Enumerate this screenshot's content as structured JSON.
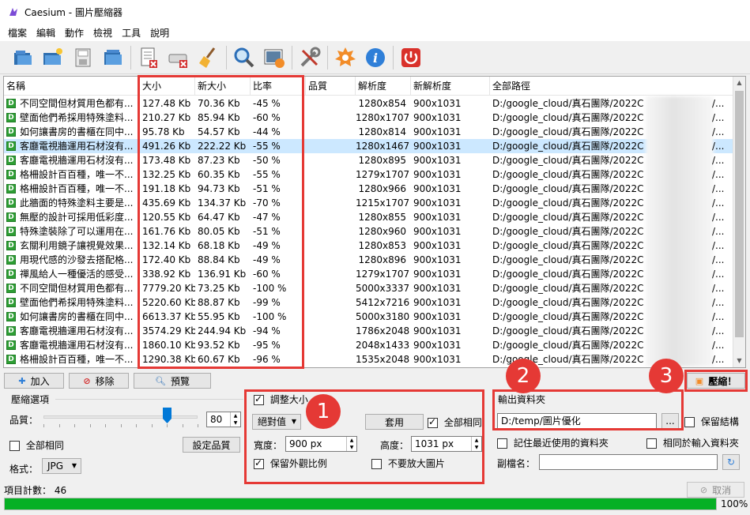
{
  "window": {
    "title": "Caesium - 圖片壓縮器"
  },
  "menu": [
    "檔案",
    "編輯",
    "動作",
    "檢視",
    "工具",
    "說明"
  ],
  "toolbar": {
    "icons": [
      "open-file-icon",
      "open-folder-icon",
      "save-icon",
      "save-all-icon",
      "remove-item-icon",
      "clear-list-icon",
      "broom-clean-icon",
      "search-icon",
      "preview-image-icon",
      "settings-tools-icon",
      "update-icon",
      "info-icon",
      "exit-icon"
    ]
  },
  "table": {
    "columns": [
      "名稱",
      "大小",
      "新大小",
      "比率",
      "品質",
      "解析度",
      "新解析度",
      "全部路徑"
    ],
    "rows": [
      {
        "name": "不同空間但材質用色都有...",
        "size": "127.48 Kb",
        "new_size": "70.36 Kb",
        "ratio": "-45 %",
        "res": "1280x854",
        "new_res": "900x1031",
        "path": "D:/google_cloud/真石團隊/2022C",
        "tail": "/..."
      },
      {
        "name": "壁面他們希採用特殊塗料...",
        "size": "210.27 Kb",
        "new_size": "85.94 Kb",
        "ratio": "-60 %",
        "res": "1280x1707",
        "new_res": "900x1031",
        "path": "D:/google_cloud/真石團隊/2022C",
        "tail": "/..."
      },
      {
        "name": "如何讓書房的書櫃在同中...",
        "size": "95.78 Kb",
        "new_size": "54.57 Kb",
        "ratio": "-44 %",
        "res": "1280x814",
        "new_res": "900x1031",
        "path": "D:/google_cloud/真石團隊/2022C",
        "tail": "/..."
      },
      {
        "name": "客廳電視牆運用石材沒有...",
        "size": "491.26 Kb",
        "new_size": "222.22 Kb",
        "ratio": "-55 %",
        "res": "1280x1467",
        "new_res": "900x1031",
        "path": "D:/google_cloud/真石團隊/2022C",
        "tail": "/..."
      },
      {
        "name": "客廳電視牆運用石材沒有...",
        "size": "173.48 Kb",
        "new_size": "87.23 Kb",
        "ratio": "-50 %",
        "res": "1280x895",
        "new_res": "900x1031",
        "path": "D:/google_cloud/真石團隊/2022C",
        "tail": "/..."
      },
      {
        "name": "格柵設計百百種，唯一不...",
        "size": "132.25 Kb",
        "new_size": "60.35 Kb",
        "ratio": "-55 %",
        "res": "1279x1707",
        "new_res": "900x1031",
        "path": "D:/google_cloud/真石團隊/2022C",
        "tail": "/..."
      },
      {
        "name": "格柵設計百百種，唯一不...",
        "size": "191.18 Kb",
        "new_size": "94.73 Kb",
        "ratio": "-51 %",
        "res": "1280x966",
        "new_res": "900x1031",
        "path": "D:/google_cloud/真石團隊/2022C",
        "tail": "/..."
      },
      {
        "name": "此牆面的特殊塗料主要是...",
        "size": "435.69 Kb",
        "new_size": "134.37 Kb",
        "ratio": "-70 %",
        "res": "1215x1707",
        "new_res": "900x1031",
        "path": "D:/google_cloud/真石團隊/2022C",
        "tail": "/..."
      },
      {
        "name": "無壓的設計可採用低彩度...",
        "size": "120.55 Kb",
        "new_size": "64.47 Kb",
        "ratio": "-47 %",
        "res": "1280x855",
        "new_res": "900x1031",
        "path": "D:/google_cloud/真石團隊/2022C",
        "tail": "/..."
      },
      {
        "name": "特殊塗裝除了可以運用在...",
        "size": "161.76 Kb",
        "new_size": "80.05 Kb",
        "ratio": "-51 %",
        "res": "1280x960",
        "new_res": "900x1031",
        "path": "D:/google_cloud/真石團隊/2022C",
        "tail": "/..."
      },
      {
        "name": "玄關利用鏡子讓視覺效果...",
        "size": "132.14 Kb",
        "new_size": "68.18 Kb",
        "ratio": "-49 %",
        "res": "1280x853",
        "new_res": "900x1031",
        "path": "D:/google_cloud/真石團隊/2022C",
        "tail": "/..."
      },
      {
        "name": "用現代感的沙發去搭配格...",
        "size": "172.40 Kb",
        "new_size": "88.84 Kb",
        "ratio": "-49 %",
        "res": "1280x896",
        "new_res": "900x1031",
        "path": "D:/google_cloud/真石團隊/2022C",
        "tail": "/..."
      },
      {
        "name": "禪風給人一種優活的感受...",
        "size": "338.92 Kb",
        "new_size": "136.91 Kb",
        "ratio": "-60 %",
        "res": "1279x1707",
        "new_res": "900x1031",
        "path": "D:/google_cloud/真石團隊/2022C",
        "tail": "/..."
      },
      {
        "name": "不同空間但材質用色都有...",
        "size": "7779.20 Kb",
        "new_size": "73.25 Kb",
        "ratio": "-100 %",
        "res": "5000x3337",
        "new_res": "900x1031",
        "path": "D:/google_cloud/真石團隊/2022C",
        "tail": "/..."
      },
      {
        "name": "壁面他們希採用特殊塗料...",
        "size": "5220.60 Kb",
        "new_size": "88.87 Kb",
        "ratio": "-99 %",
        "res": "5412x7216",
        "new_res": "900x1031",
        "path": "D:/google_cloud/真石團隊/2022C",
        "tail": "/..."
      },
      {
        "name": "如何讓書房的書櫃在同中...",
        "size": "6613.37 Kb",
        "new_size": "55.95 Kb",
        "ratio": "-100 %",
        "res": "5000x3180",
        "new_res": "900x1031",
        "path": "D:/google_cloud/真石團隊/2022C",
        "tail": "/..."
      },
      {
        "name": "客廳電視牆運用石材沒有...",
        "size": "3574.29 Kb",
        "new_size": "244.94 Kb",
        "ratio": "-94 %",
        "res": "1786x2048",
        "new_res": "900x1031",
        "path": "D:/google_cloud/真石團隊/2022C",
        "tail": "/..."
      },
      {
        "name": "客廳電視牆運用石材沒有...",
        "size": "1860.10 Kb",
        "new_size": "93.52 Kb",
        "ratio": "-95 %",
        "res": "2048x1433",
        "new_res": "900x1031",
        "path": "D:/google_cloud/真石團隊/2022C",
        "tail": "/..."
      },
      {
        "name": "格柵設計百百種，唯一不...",
        "size": "1290.38 Kb",
        "new_size": "60.67 Kb",
        "ratio": "-96 %",
        "res": "1535x2048",
        "new_res": "900x1031",
        "path": "D:/google_cloud/真石團隊/2022C",
        "tail": "/..."
      }
    ],
    "selected_index": 3
  },
  "actions": {
    "add": "加入",
    "remove": "移除",
    "preview": "預覽",
    "compress": "壓縮！"
  },
  "compression": {
    "group_title": "壓縮選項",
    "quality_label": "品質：",
    "quality_value": "80",
    "quality_level": 80,
    "same_for_all": "全部相同",
    "set_quality": "設定品質",
    "format_label": "格式：",
    "format_value": "JPG"
  },
  "resize": {
    "enable_label": "調整大小",
    "mode_value": "絕對值",
    "apply": "套用",
    "same_for_all": "全部相同",
    "width_label": "寬度：",
    "width_value": "900 px",
    "height_label": "高度：",
    "height_value": "1031 px",
    "keep_ratio": "保留外觀比例",
    "no_enlarge": "不要放大圖片"
  },
  "output": {
    "group_title": "輸出資料夾",
    "folder_value": "D:/temp/圖片優化",
    "browse": "...",
    "keep_structure": "保留結構",
    "remember_last": "記住最近使用的資料夾",
    "same_as_input": "相同於輸入資料夾",
    "suffix_label": "副檔名："
  },
  "status": {
    "item_count": "項目計數：  46",
    "cancel": "取消",
    "progress_text": "100%",
    "progress_value": 100
  },
  "badges": [
    "1",
    "2",
    "3"
  ],
  "colors": {
    "highlight": "#e53935",
    "progress": "#06b025",
    "selection": "#cce8ff"
  }
}
